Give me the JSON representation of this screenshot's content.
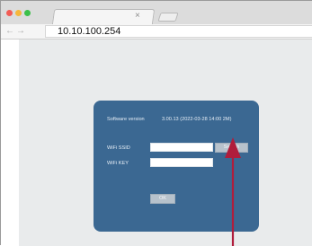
{
  "browser": {
    "tab_close_glyph": "×",
    "back_glyph": "←",
    "forward_glyph": "→",
    "url": "10.10.100.254",
    "traffic_light_colors": [
      "#f25c55",
      "#f6b73b",
      "#3cc04a"
    ]
  },
  "panel": {
    "software_version_label": "Software version",
    "software_version_value": "3.00.13 (2022-03-28 14:00 2M)",
    "wifi_ssid_label": "WiFi SSID",
    "wifi_ssid_value": "",
    "wifi_key_label": "WiFi KEY",
    "wifi_key_value": "",
    "search_button": "Search",
    "ok_button": "OK"
  },
  "colors": {
    "panel_bg": "#3b6892",
    "page_bg": "#e9ebec",
    "arrow": "#b01d3c"
  }
}
